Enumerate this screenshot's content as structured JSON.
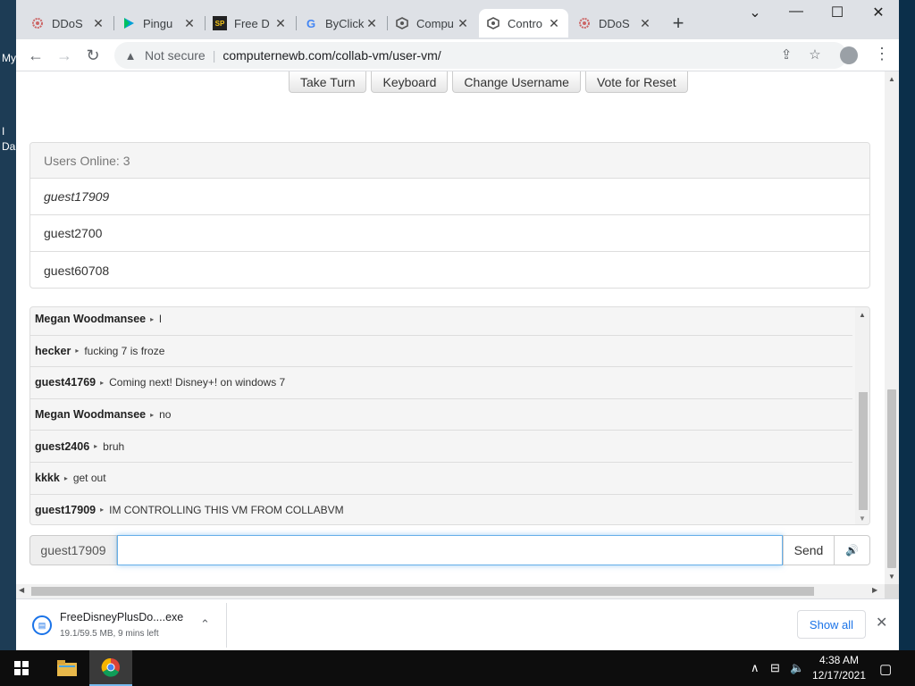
{
  "desktop": {
    "label_1": "My",
    "label_2": "I",
    "label_3": "Da"
  },
  "tabs": [
    {
      "title": "DDoS",
      "icon": "ddos-favicon-icon",
      "active": false
    },
    {
      "title": "Pingu",
      "icon": "play-favicon-icon",
      "active": false
    },
    {
      "title": "Free D",
      "icon": "sp-favicon-icon",
      "active": false
    },
    {
      "title": "ByClick",
      "icon": "google-favicon-icon",
      "active": false
    },
    {
      "title": "Compu",
      "icon": "collabvm-favicon-icon",
      "active": false
    },
    {
      "title": "Contro",
      "icon": "collabvm-favicon-icon",
      "active": true
    },
    {
      "title": "DDoS",
      "icon": "ddos-favicon-icon",
      "active": false
    }
  ],
  "tab_glyphs": {
    "sp": "SP",
    "google": "G",
    "close": "✕",
    "new_tab": "+"
  },
  "window_controls": {
    "menu": "⌄",
    "minimize": "—",
    "maximize": "☐",
    "close": "✕"
  },
  "toolbar": {
    "back": "←",
    "forward": "→",
    "reload": "↻",
    "security_icon": "▲",
    "security_label": "Not secure",
    "separator": "|",
    "url": "computernewb.com/collab-vm/user-vm/",
    "share": "⇪",
    "bookmark": "☆",
    "menu": "⋮"
  },
  "vm_buttons": [
    "Take Turn",
    "Keyboard",
    "Change Username",
    "Vote for Reset"
  ],
  "users_panel": {
    "header": "Users Online: 3",
    "users": [
      "guest17909",
      "guest2700",
      "guest60708"
    ]
  },
  "chat": {
    "arrow": "▸",
    "messages": [
      {
        "user": "Megan Woodmansee",
        "text": "l"
      },
      {
        "user": "hecker",
        "text": "fucking 7 is froze"
      },
      {
        "user": "guest41769",
        "text": "Coming next! Disney+! on windows 7"
      },
      {
        "user": "Megan Woodmansee",
        "text": "no"
      },
      {
        "user": "guest2406",
        "text": "bruh"
      },
      {
        "user": "kkkk",
        "text": "get out"
      },
      {
        "user": "guest17909",
        "text": "IM CONTROLLING THIS VM FROM COLLABVM"
      }
    ]
  },
  "chat_input": {
    "username": "guest17909",
    "value": "",
    "send_label": "Send",
    "sound_icon": "🔊"
  },
  "scroll_glyphs": {
    "up": "▲",
    "down": "▼",
    "left": "◀",
    "right": "▶"
  },
  "download": {
    "filename": "FreeDisneyPlusDo....exe",
    "status": "19.1/59.5 MB, 9 mins left",
    "file_glyph": "▤",
    "chevron": "⌃",
    "show_all": "Show all",
    "close": "✕"
  },
  "taskbar": {
    "tray_chevron": "∧",
    "network": "⊟",
    "volume": "🔈",
    "notifications": "▢",
    "time": "4:38 AM",
    "date": "12/17/2021"
  },
  "colors": {
    "accent": "#1a73e8",
    "taskbar": "#0d0d0d",
    "tabstrip": "#dee1e6"
  }
}
